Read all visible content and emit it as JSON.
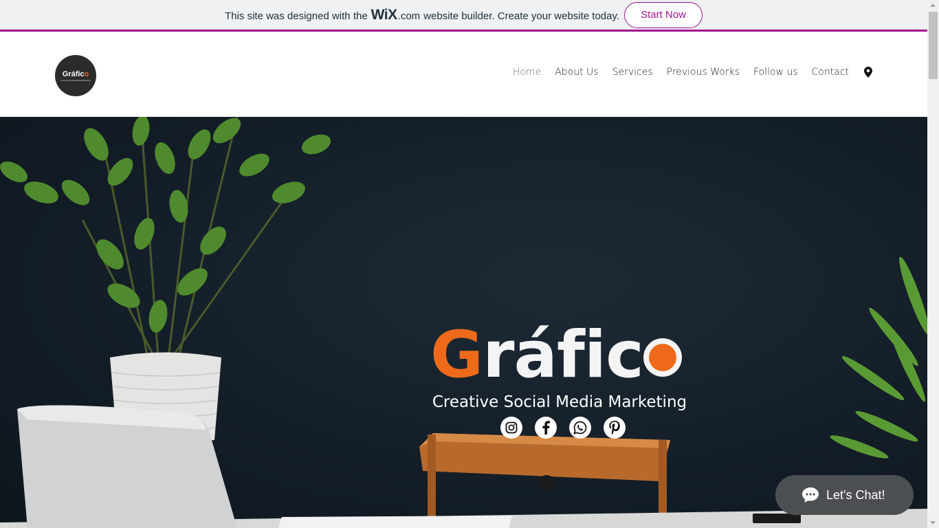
{
  "banner": {
    "text_before": "This site was designed with the",
    "wix_logo": "WiX",
    "dotcom": ".com",
    "text_after": "website builder. Create your website today.",
    "cta_label": "Start Now",
    "accent_color": "#a0138e"
  },
  "header": {
    "logo": {
      "title": "Gráfico",
      "subtitle": "Creative Social Media Marketing"
    },
    "nav": [
      {
        "label": "Home",
        "active": true
      },
      {
        "label": "About Us"
      },
      {
        "label": "Services"
      },
      {
        "label": "Previous Works"
      },
      {
        "label": "Follow us"
      },
      {
        "label": "Contact"
      }
    ],
    "map_icon": "map-pin-icon"
  },
  "hero": {
    "brand_g": "G",
    "brand_ra": "rá",
    "brand_fic": "fic",
    "brand_full": "Gráfico",
    "tagline": "Creative Social Media Marketing",
    "brand_color": "#ee6a1a",
    "socials": [
      "instagram-icon",
      "facebook-icon",
      "whatsapp-icon",
      "pinterest-icon"
    ]
  },
  "chat": {
    "label": "Let's Chat!",
    "icon": "chat-bubble-icon"
  }
}
